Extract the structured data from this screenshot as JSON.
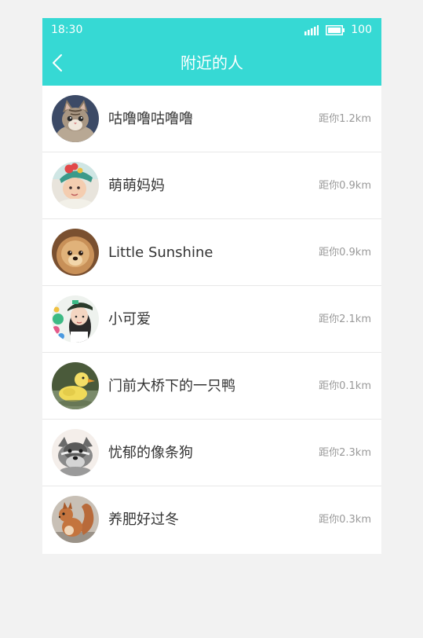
{
  "status_bar": {
    "time": "18:30",
    "battery_level": "100",
    "signal_icon": "signal-icon",
    "battery_icon": "battery-icon"
  },
  "header": {
    "title": "附近的人",
    "back_icon": "back-icon",
    "background_color": "#36d9d4"
  },
  "people": [
    {
      "name": "咕噜噜咕噜噜",
      "distance": "距你1.2km",
      "avatar": "kitten-avatar"
    },
    {
      "name": "萌萌妈妈",
      "distance": "距你0.9km",
      "avatar": "baby-avatar"
    },
    {
      "name": "Little Sunshine",
      "distance": "距你0.9km",
      "avatar": "puppy-avatar"
    },
    {
      "name": "小可爱",
      "distance": "距你2.1km",
      "avatar": "girl-avatar"
    },
    {
      "name": "门前大桥下的一只鸭",
      "distance": "距你0.1km",
      "avatar": "duckling-avatar"
    },
    {
      "name": "忧郁的像条狗",
      "distance": "距你2.3km",
      "avatar": "schnauzer-avatar"
    },
    {
      "name": "养肥好过冬",
      "distance": "距你0.3km",
      "avatar": "squirrel-avatar"
    }
  ]
}
